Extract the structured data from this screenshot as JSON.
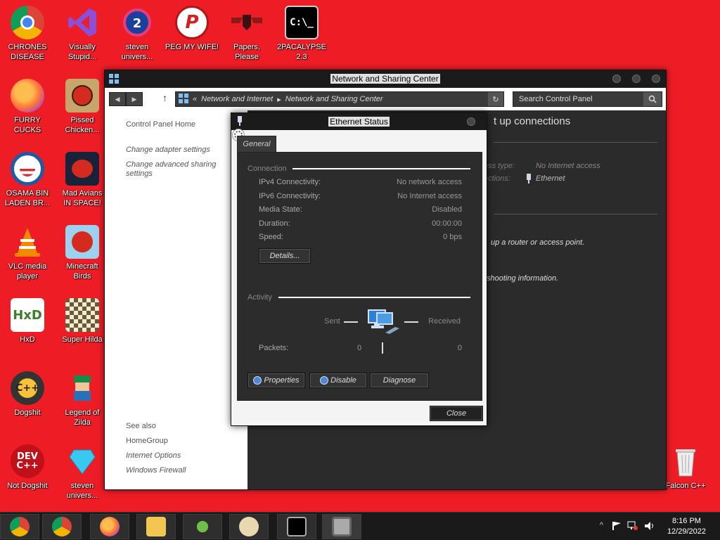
{
  "desktop": {
    "icons": [
      {
        "label": "CHRONES\nDISEASE"
      },
      {
        "label": "FURRY CUCKS"
      },
      {
        "label": "OSAMA BIN\nLADEN BR..."
      },
      {
        "label": "VLC media\nplayer"
      },
      {
        "label": "HxD"
      },
      {
        "label": "Dogshit"
      },
      {
        "label": "Not Dogshit"
      },
      {
        "label": "Visually\nStupid..."
      },
      {
        "label": "Pissed\nChicken..."
      },
      {
        "label": "Mad Avians\nIN SPACE!"
      },
      {
        "label": "Minecraft\nBirds"
      },
      {
        "label": "Super Hilda"
      },
      {
        "label": "Legend of\nZilda"
      },
      {
        "label": "steven\nunivers..."
      },
      {
        "label": "steven\nunivers..."
      },
      {
        "label": "PEG MY WIFE!"
      },
      {
        "label": "Papers,\nPlease"
      },
      {
        "label": "2PACALYPSE\n2.3"
      },
      {
        "label": "Falcon C++"
      }
    ],
    "icon_glyphs": {
      "hxd": "HxD",
      "dev": "DEV\nC++",
      "cmd": "C:\\_"
    }
  },
  "nsc_window": {
    "title": "Network and Sharing Center",
    "breadcrumb": {
      "prefix": "«",
      "part1": "Network and Internet",
      "sep": "▸",
      "part2": "Network and Sharing Center"
    },
    "search_placeholder": "Search Control Panel",
    "sidebar": {
      "home": "Control Panel Home",
      "change_adapter": "Change adapter settings",
      "change_sharing": "Change advanced sharing\nsettings",
      "see_also": "See also",
      "homegroup": "HomeGroup",
      "internet_options": "Internet Options",
      "firewall": "Windows Firewall"
    },
    "content": {
      "heading_fragment": "t up connections",
      "access_type_label": "ess type:",
      "access_type_value": "No Internet access",
      "connections_label": "ections:",
      "connections_value": "Ethernet",
      "router_text": "up a router or access point.",
      "troubleshoot_text": "shooting information."
    }
  },
  "eth_dialog": {
    "title": "Ethernet Status",
    "tab": "General",
    "connection_header": "Connection",
    "rows": [
      {
        "label": "IPv4 Connectivity:",
        "value": "No network access"
      },
      {
        "label": "IPv6 Connectivity:",
        "value": "No Internet access"
      },
      {
        "label": "Media State:",
        "value": "Disabled"
      },
      {
        "label": "Duration:",
        "value": "00:00:00"
      },
      {
        "label": "Speed:",
        "value": "0 bps"
      }
    ],
    "details_button": "Details...",
    "activity_header": "Activity",
    "sent_label": "Sent",
    "received_label": "Received",
    "packets_label": "Packets:",
    "packets_sent": "0",
    "packets_received": "0",
    "properties_button": "Properties",
    "disable_button": "Disable",
    "diagnose_button": "Diagnose",
    "close_button": "Close"
  },
  "taskbar": {
    "clock_time": "8:16 PM",
    "clock_date": "12/29/2022",
    "tray_chevron": "^"
  },
  "colors": {
    "desktop_bg": "#ee1c25",
    "window_dark": "#2b2b2b",
    "titlebar": "#1b1b1b"
  }
}
